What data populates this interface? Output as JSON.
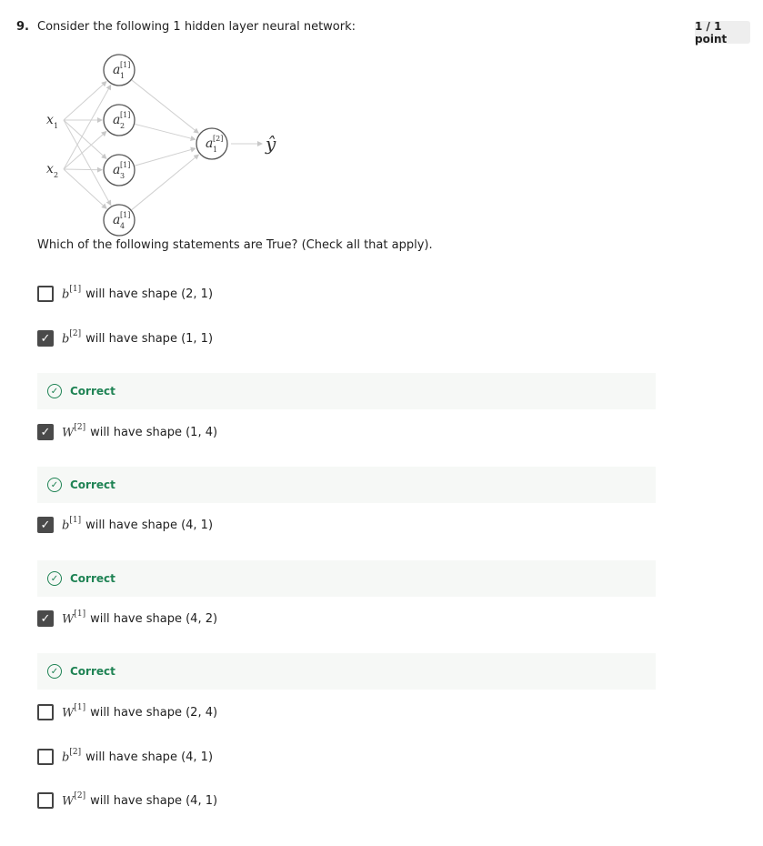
{
  "question": {
    "number": "9.",
    "text": "Consider the following 1 hidden layer neural network:",
    "score": "1 / 1 point",
    "prompt": "Which of the following statements are True? (Check all that apply)."
  },
  "diagram": {
    "inputs": [
      {
        "base": "x",
        "sub": "1"
      },
      {
        "base": "x",
        "sub": "2"
      }
    ],
    "hidden": [
      {
        "base": "a",
        "sup": "[1]",
        "sub": "1"
      },
      {
        "base": "a",
        "sup": "[1]",
        "sub": "2"
      },
      {
        "base": "a",
        "sup": "[1]",
        "sub": "3"
      },
      {
        "base": "a",
        "sup": "[1]",
        "sub": "4"
      }
    ],
    "output": {
      "base": "a",
      "sup": "[2]",
      "sub": "1"
    },
    "prediction": "ŷ"
  },
  "options": [
    {
      "sym": "b",
      "sup": "[1]",
      "text": "will have shape (2, 1)",
      "checked": false
    },
    {
      "sym": "b",
      "sup": "[2]",
      "text": "will have shape (1, 1)",
      "checked": true,
      "feedback": "Correct"
    },
    {
      "sym": "W",
      "sup": "[2]",
      "text": "will have shape (1, 4)",
      "checked": true,
      "feedback": "Correct"
    },
    {
      "sym": "b",
      "sup": "[1]",
      "text": "will have shape (4, 1)",
      "checked": true,
      "feedback": "Correct"
    },
    {
      "sym": "W",
      "sup": "[1]",
      "text": "will have shape (4, 2)",
      "checked": true,
      "feedback": "Correct"
    },
    {
      "sym": "W",
      "sup": "[1]",
      "text": "will have shape (2, 4)",
      "checked": false
    },
    {
      "sym": "b",
      "sup": "[2]",
      "text": "will have shape (4, 1)",
      "checked": false
    },
    {
      "sym": "W",
      "sup": "[2]",
      "text": "will have shape (4, 1)",
      "checked": false
    }
  ],
  "icons": {
    "checkbox_checked": "check-icon",
    "feedback": "check-circle-icon"
  },
  "colors": {
    "correct": "#1f8354",
    "checkbox_checked": "#4a4a4a",
    "feedback_bg": "#f6f8f6"
  }
}
